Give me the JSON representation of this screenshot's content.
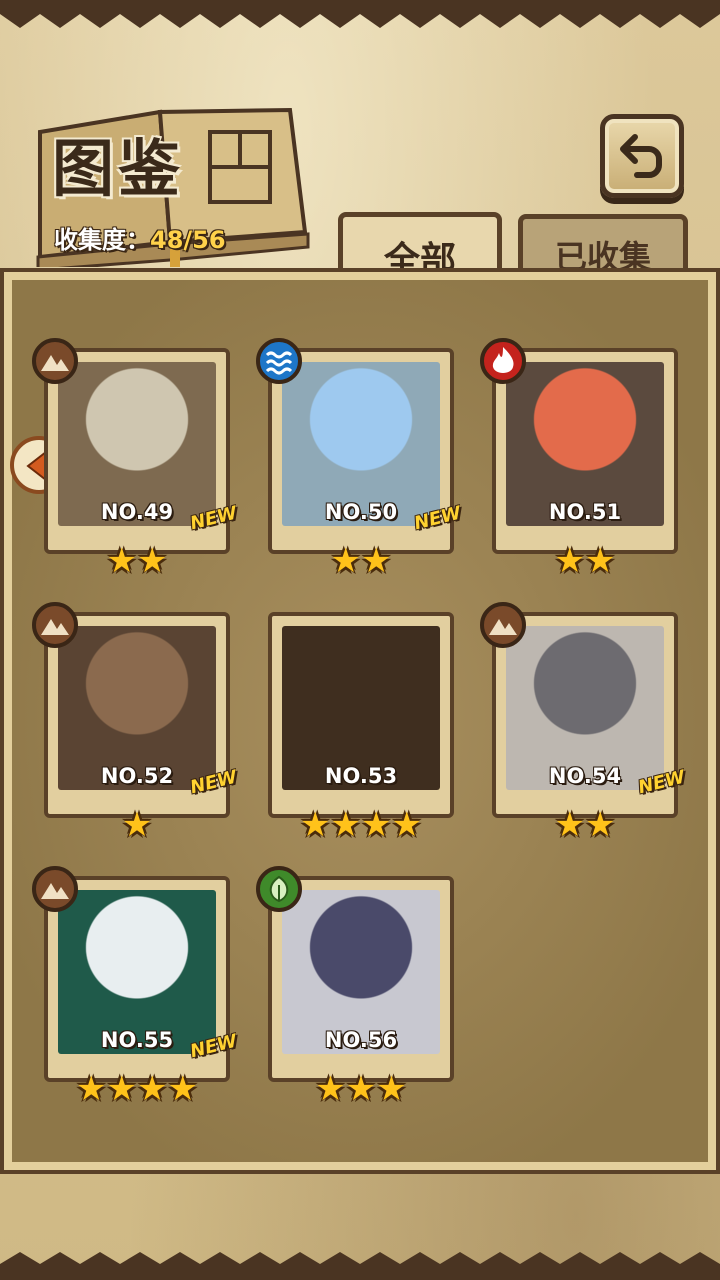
{
  "header": {
    "title": "图鉴",
    "collection_label": "收集度：",
    "collection_value": "48/56"
  },
  "tabs": [
    {
      "label": "全部",
      "active": true
    },
    {
      "label": "已收集",
      "active": false
    }
  ],
  "cards": [
    {
      "number": "NO.49",
      "is_new": true,
      "new_label": "NEW",
      "stars": "★★",
      "element": "earth-icon",
      "element_color": "#7a4a2a",
      "colors": [
        "#cfc6b0",
        "#7e6a50"
      ]
    },
    {
      "number": "NO.50",
      "is_new": true,
      "new_label": "NEW",
      "stars": "★★",
      "element": "water-icon",
      "element_color": "#1e76c8",
      "colors": [
        "#9ec9ef",
        "#8fa9b7"
      ]
    },
    {
      "number": "NO.51",
      "is_new": false,
      "new_label": "",
      "stars": "★★",
      "element": "fire-icon",
      "element_color": "#c4231d",
      "colors": [
        "#e36b4b",
        "#5b4a3e"
      ]
    },
    {
      "number": "NO.52",
      "is_new": true,
      "new_label": "NEW",
      "stars": "★",
      "element": "earth-icon",
      "element_color": "#7a4a2a",
      "colors": [
        "#8b6a4e",
        "#5a4433"
      ]
    },
    {
      "number": "NO.53",
      "is_new": false,
      "new_label": "",
      "stars": "★★★★",
      "element": "",
      "element_color": "",
      "colors": [
        "#3f2e1f",
        "#3f2e1f"
      ]
    },
    {
      "number": "NO.54",
      "is_new": true,
      "new_label": "NEW",
      "stars": "★★",
      "element": "earth-icon",
      "element_color": "#7a4a2a",
      "colors": [
        "#6d6b70",
        "#bdb7b0"
      ]
    },
    {
      "number": "NO.55",
      "is_new": true,
      "new_label": "NEW",
      "stars": "★★★★",
      "element": "earth-icon",
      "element_color": "#7a4a2a",
      "colors": [
        "#e8eef0",
        "#1f5a4a"
      ]
    },
    {
      "number": "NO.56",
      "is_new": false,
      "new_label": "",
      "stars": "★★★",
      "element": "leaf-icon",
      "element_color": "#3f8a2a",
      "colors": [
        "#4a4a6a",
        "#c8c8d0"
      ]
    }
  ]
}
